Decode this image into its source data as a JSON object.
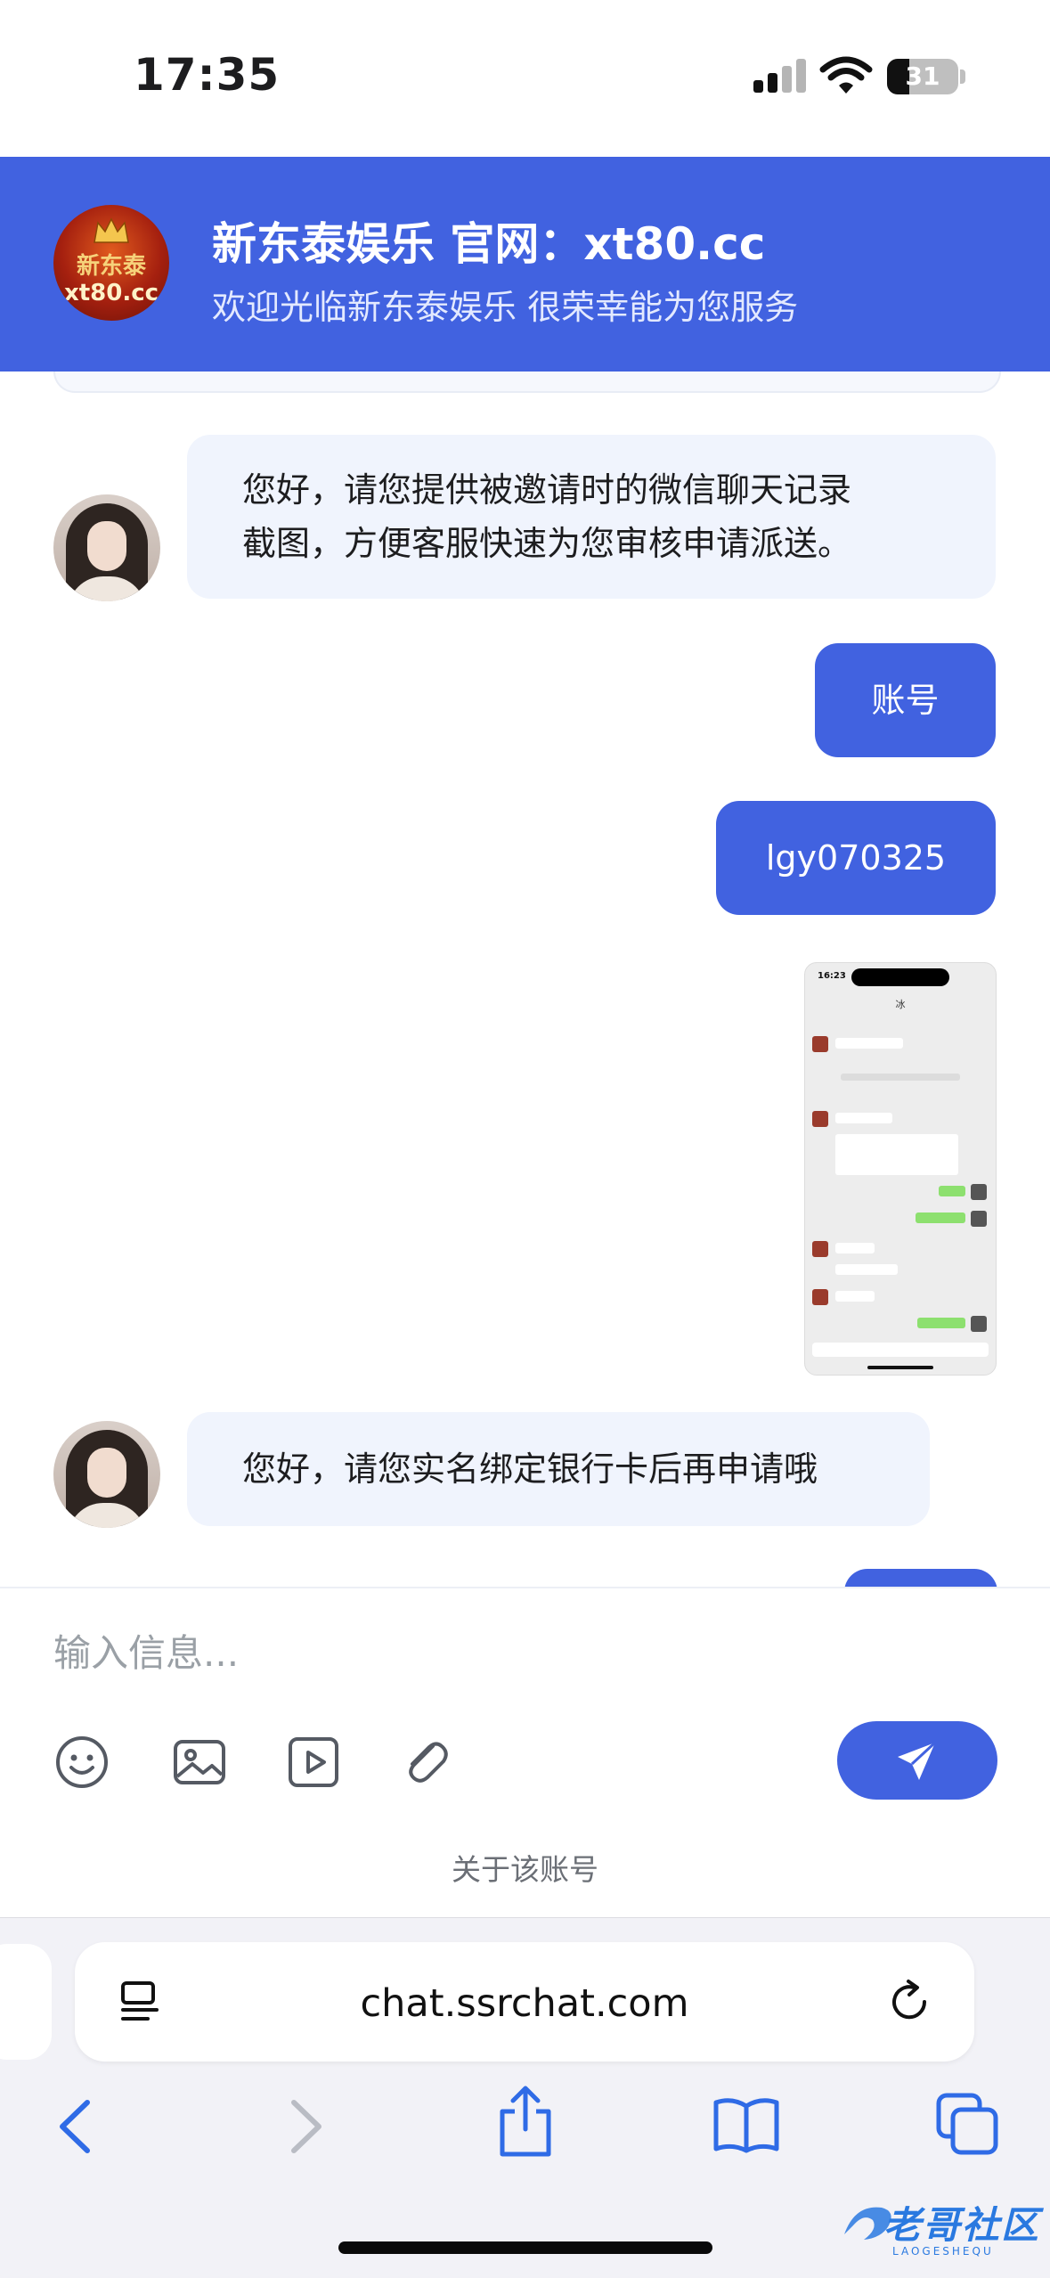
{
  "status_bar": {
    "time": "17:35",
    "battery": "31",
    "battery_level_percent": 31
  },
  "header": {
    "logo_text_top": "新东泰",
    "logo_text_bottom": "xt80.cc",
    "title": "新东泰娱乐 官网：xt80.cc",
    "subtitle": "欢迎光临新东泰娱乐 很荣幸能为您服务"
  },
  "messages": [
    {
      "from": "agent",
      "lines": [
        "您好，请您提供被邀请时的微信聊天记录",
        "截图，方便客服快速为您审核申请派送。"
      ]
    },
    {
      "from": "user",
      "text": "账号"
    },
    {
      "from": "user",
      "text": "lgy070325"
    },
    {
      "from": "user",
      "type": "image",
      "mini_time": "16:23",
      "mini_title": "冰"
    },
    {
      "from": "agent",
      "lines": [
        "您好，请您实名绑定银行卡后再申请哦"
      ]
    }
  ],
  "composer": {
    "placeholder": "输入信息...",
    "tools": [
      "emoji-icon",
      "image-icon",
      "video-icon",
      "attachment-icon"
    ],
    "send_icon": "send-icon"
  },
  "about_link": "关于该账号",
  "browser": {
    "url": "chat.ssrchat.com",
    "nav": [
      "back-icon",
      "forward-icon",
      "share-icon",
      "bookmarks-icon",
      "tabs-icon"
    ]
  },
  "watermark": {
    "text": "老哥社区",
    "sub": "LAOGESHEQU"
  },
  "colors": {
    "accent": "#4162e0",
    "agent_bubble": "#f0f4fd",
    "browser_bg": "#f2f2f7"
  }
}
